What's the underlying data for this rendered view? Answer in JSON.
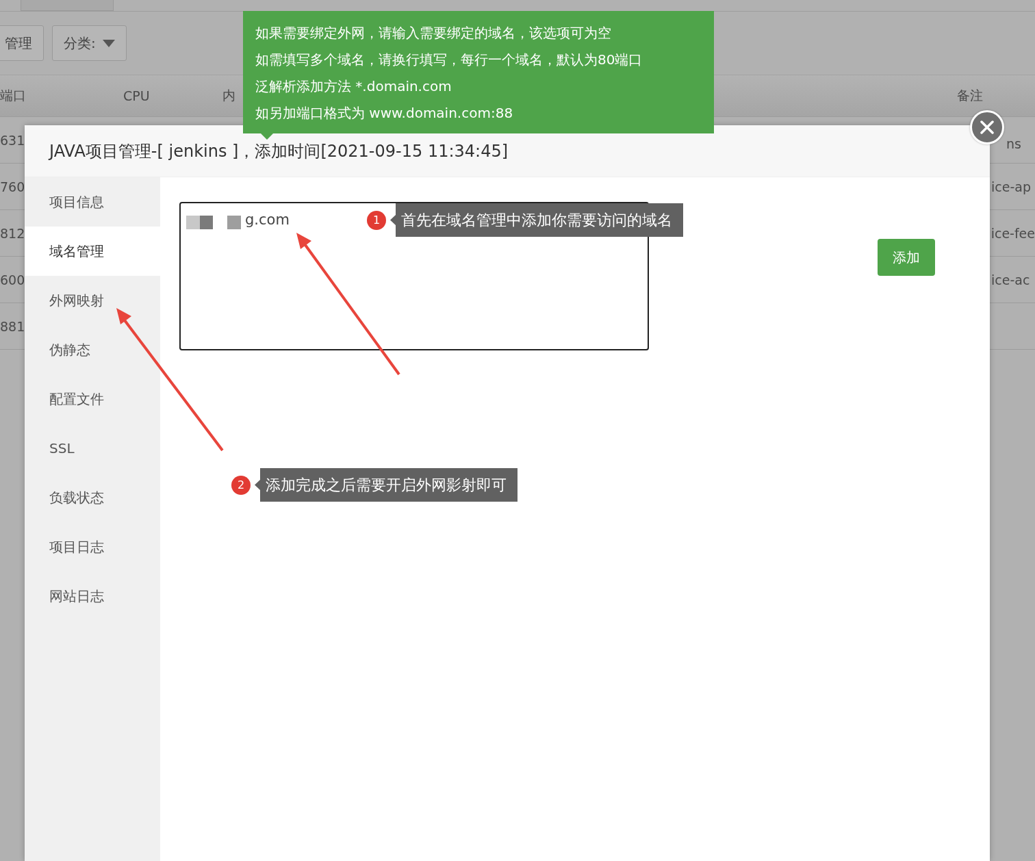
{
  "background": {
    "toolbar": {
      "manage_button": "管理",
      "category_dropdown": "分类:"
    },
    "table": {
      "columns": [
        "端口",
        "CPU",
        "内",
        "备注"
      ],
      "rows": [
        {
          "column_1": "631",
          "remark": "ns"
        },
        {
          "column_1": "760",
          "remark": "ice-ap"
        },
        {
          "column_1": "812",
          "remark": "ice-fee"
        },
        {
          "column_1": "600",
          "remark": "ice-ac"
        },
        {
          "column_1": "881"
        }
      ]
    }
  },
  "tooltip": {
    "lines": [
      "如果需要绑定外网，请输入需要绑定的域名，该选项可为空",
      "如需填写多个域名，请换行填写，每行一个域名，默认为80端口",
      "泛解析添加方法 *.domain.com",
      "如另加端口格式为 www.domain.com:88"
    ]
  },
  "dialog": {
    "title": "JAVA项目管理-[ jenkins ]，添加时间[2021-09-15 11:34:45]",
    "tabs": [
      {
        "label": "项目信息",
        "selected": false
      },
      {
        "label": "域名管理",
        "selected": true
      },
      {
        "label": "外网映射",
        "selected": false
      },
      {
        "label": "伪静态",
        "selected": false
      },
      {
        "label": "配置文件",
        "selected": false
      },
      {
        "label": "SSL",
        "selected": false
      },
      {
        "label": "负载状态",
        "selected": false
      },
      {
        "label": "项目日志",
        "selected": false
      },
      {
        "label": "网站日志",
        "selected": false
      }
    ],
    "domains": "g.com",
    "add_button": "添加"
  },
  "annotations": [
    {
      "number": "1",
      "text": "首先在域名管理中添加你需要访问的域名"
    },
    {
      "number": "2",
      "text": "添加完成之后需要开启外网影射即可"
    }
  ]
}
